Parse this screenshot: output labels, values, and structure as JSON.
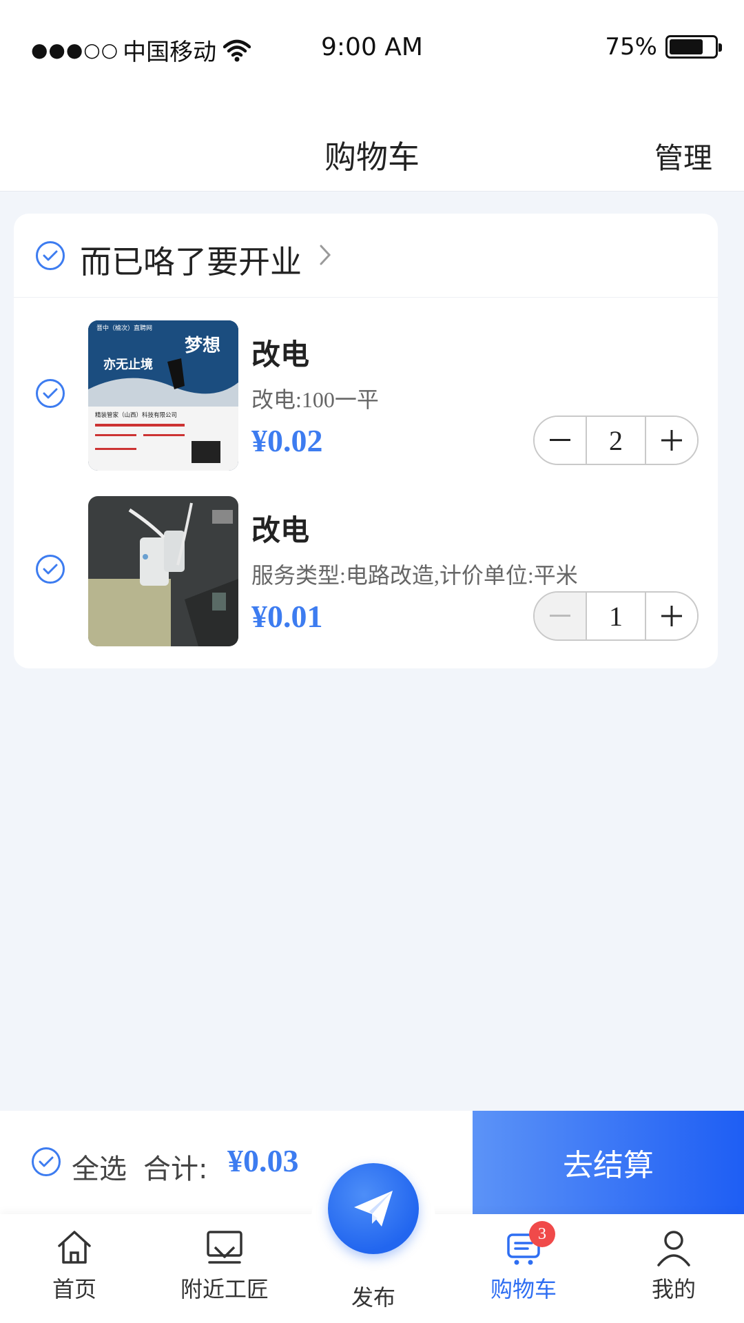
{
  "status_bar": {
    "signal": "●●●○○",
    "carrier": "中国移动",
    "time": "9:00 AM",
    "battery": "75%",
    "battery_level": 0.75
  },
  "header": {
    "title": "购物车",
    "manage_label": "管理"
  },
  "shop": {
    "name": "而已咯了要开业",
    "items": [
      {
        "title": "改电",
        "desc": "改电:100一平",
        "price": "¥0.02",
        "quantity": "2",
        "thumb_texts": {
          "top": "晋中（榆次）直聘网",
          "headline": "亦无止境",
          "slogan": "梦想",
          "company": "精装管家（山西）科技有限公司"
        }
      },
      {
        "title": "改电",
        "desc": "服务类型:电路改造,计价单位:平米",
        "price": "¥0.01",
        "quantity": "1"
      }
    ]
  },
  "checkout": {
    "select_all_label": "全选",
    "total_label": "合计:",
    "total_price": "¥0.03",
    "button_label": "去结算"
  },
  "tabs": [
    {
      "label": "首页",
      "icon": "home-icon"
    },
    {
      "label": "附近工匠",
      "icon": "nearby-icon"
    },
    {
      "label": "发布",
      "icon": "paper-plane-icon"
    },
    {
      "label": "购物车",
      "icon": "cart-icon",
      "badge": "3",
      "active": true
    },
    {
      "label": "我的",
      "icon": "user-icon"
    }
  ],
  "colors": {
    "accent": "#3d7cf0",
    "badge": "#f04a4a",
    "background": "#f2f5fa"
  }
}
